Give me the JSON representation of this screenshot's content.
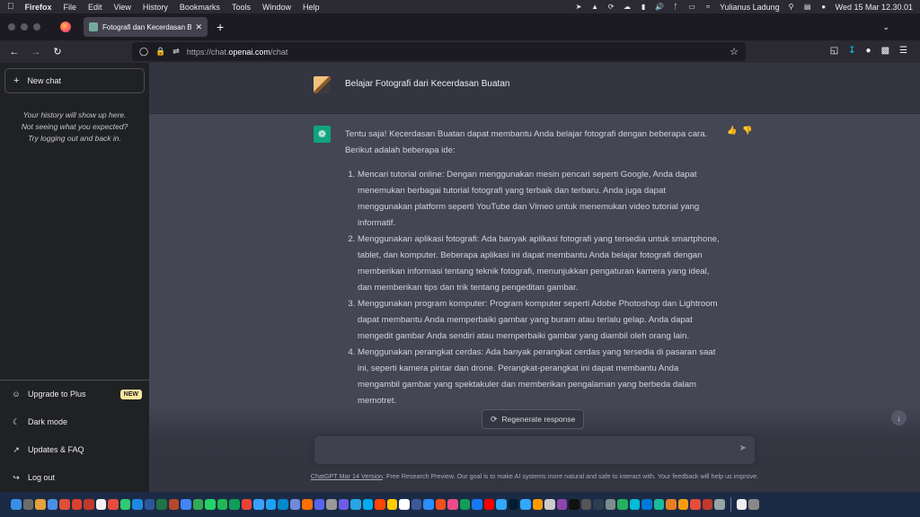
{
  "menubar": {
    "app": "Firefox",
    "items": [
      "File",
      "Edit",
      "View",
      "History",
      "Bookmarks",
      "Tools",
      "Window",
      "Help"
    ],
    "user": "Yulianus Ladung",
    "datetime": "Wed 15 Mar  12.30.01"
  },
  "browser": {
    "tab_title": "Fotografi dan Kecerdasan Buata",
    "url_prefix": "https://chat.",
    "url_domain": "openai.com",
    "url_path": "/chat"
  },
  "sidebar": {
    "new_chat": "New chat",
    "history_lines": [
      "Your history will show up here.",
      "Not seeing what you expected?",
      "Try logging out and back in."
    ],
    "items": [
      {
        "label": "Upgrade to Plus",
        "icon": "user-icon",
        "badge": "NEW"
      },
      {
        "label": "Dark mode",
        "icon": "moon-icon"
      },
      {
        "label": "Updates & FAQ",
        "icon": "external-link-icon"
      },
      {
        "label": "Log out",
        "icon": "logout-icon"
      }
    ]
  },
  "conversation": {
    "user_message": "Belajar Fotografi dari Kecerdasan Buatan",
    "assistant_intro": "Tentu saja! Kecerdasan Buatan dapat membantu Anda belajar fotografi dengan beberapa cara. Berikut adalah beberapa ide:",
    "assistant_points": [
      "Mencari tutorial online: Dengan menggunakan mesin pencari seperti Google, Anda dapat menemukan berbagai tutorial fotografi yang terbaik dan terbaru. Anda juga dapat menggunakan platform seperti YouTube dan Vimeo untuk menemukan video tutorial yang informatif.",
      "Menggunakan aplikasi fotografi: Ada banyak aplikasi fotografi yang tersedia untuk smartphone, tablet, dan komputer. Beberapa aplikasi ini dapat membantu Anda belajar fotografi dengan memberikan informasi tentang teknik fotografi, menunjukkan pengaturan kamera yang ideal, dan memberikan tips dan trik tentang pengeditan gambar.",
      "Menggunakan program komputer: Program komputer seperti Adobe Photoshop dan Lightroom dapat membantu Anda memperbaiki gambar yang buram atau terlalu gelap. Anda dapat mengedit gambar Anda sendiri atau memperbaiki gambar yang diambil oleh orang lain.",
      "Menggunakan perangkat cerdas: Ada banyak perangkat cerdas yang tersedia di pasaran saat ini, seperti kamera pintar dan drone. Perangkat-perangkat ini dapat membantu Anda mengambil gambar yang spektakuler dan memberikan pengalaman yang berbeda dalam memotret."
    ]
  },
  "composer": {
    "regenerate": "Regenerate response",
    "placeholder": ""
  },
  "footer": {
    "version_link": "ChatGPT Mar 14 Version",
    "text": ". Free Research Preview. Our goal is to make AI systems more natural and safe to interact with. Your feedback will help us improve."
  },
  "colors": {
    "sidebar_bg": "#202123",
    "main_bg": "#343541",
    "assistant_bg": "#444654",
    "gpt_green": "#10a37f",
    "badge_yellow": "#fae69e"
  },
  "dock_icon_colors": [
    "#3a8ee6",
    "#6c6c6c",
    "#e6a23a",
    "#4a90e2",
    "#e04e39",
    "#d9412f",
    "#c0392b",
    "#f2f2f2",
    "#e74c3c",
    "#2ecc71",
    "#1e88e5",
    "#2b5797",
    "#217346",
    "#b7472a",
    "#4285f4",
    "#34a853",
    "#25d366",
    "#1db954",
    "#0f9d58",
    "#ea4335",
    "#3aa0ff",
    "#1da1f2",
    "#0088cc",
    "#7289da",
    "#ff6f00",
    "#5865f2",
    "#999999",
    "#6c5ce7",
    "#26a5e4",
    "#00acee",
    "#ff4500",
    "#ffcc00",
    "#ffffff",
    "#3b5998",
    "#2d8cff",
    "#f24e1e",
    "#ea4c89",
    "#0f9d58",
    "#1877f2",
    "#ff0000",
    "#31a8ff",
    "#001e36",
    "#31a8ff",
    "#ff9a00",
    "#cccccc",
    "#8e44ad",
    "#111111",
    "#555555",
    "#2c3e50",
    "#7f8c8d",
    "#27ae60",
    "#00bcd4",
    "#0078d7",
    "#1abc9c",
    "#e67e22",
    "#f39c12",
    "#e74c3c",
    "#c0392b",
    "#95a5a6",
    "#eeeeee",
    "#888888"
  ]
}
